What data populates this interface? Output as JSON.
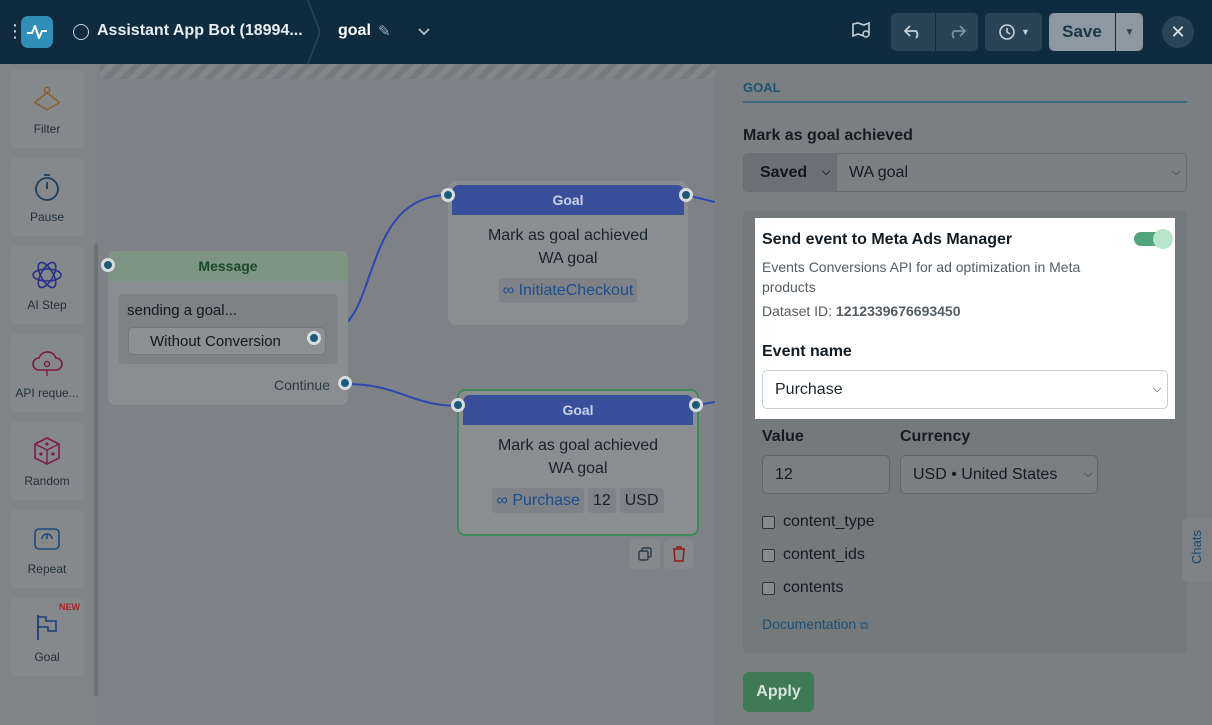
{
  "topbar": {
    "bot_title": "Assistant App Bot (18994...",
    "flow_name": "goal",
    "save_label": "Save"
  },
  "tools": [
    {
      "label": "Filter"
    },
    {
      "label": "Pause"
    },
    {
      "label": "AI Step"
    },
    {
      "label": "API reque..."
    },
    {
      "label": "Random"
    },
    {
      "label": "Repeat"
    },
    {
      "label": "Goal",
      "badge": "NEW"
    }
  ],
  "nodes": {
    "message": {
      "header": "Message",
      "text": "sending a goal...",
      "button": "Without Conversion",
      "continue": "Continue"
    },
    "goal1": {
      "header": "Goal",
      "line1": "Mark as goal achieved",
      "line2": "WA goal",
      "event": "InitiateCheckout"
    },
    "goal2": {
      "header": "Goal",
      "line1": "Mark as goal achieved",
      "line2": "WA goal",
      "event": "Purchase",
      "value": "12",
      "currency": "USD"
    }
  },
  "panel": {
    "section_tab": "GOAL",
    "mark_label": "Mark as goal achieved",
    "status_select": "Saved",
    "goal_select": "WA goal",
    "meta": {
      "title": "Send event to Meta Ads Manager",
      "description": "Events Conversions API for ad optimization in Meta products",
      "dataset_label": "Dataset ID:",
      "dataset_id": "1212339676693450",
      "toggle_on": true
    },
    "event_name_label": "Event name",
    "event_name_value": "Purchase",
    "value_label": "Value",
    "value": "12",
    "currency_label": "Currency",
    "currency_value": "USD • United States",
    "checkboxes": [
      "content_type",
      "content_ids",
      "contents"
    ],
    "documentation": "Documentation",
    "apply": "Apply"
  },
  "chats_tab": "Chats",
  "colors": {
    "topbar": "#0f2b3d",
    "accent_blue": "#2f8fb8",
    "toggle_green": "#52a57a",
    "apply_green": "#3f7a55"
  }
}
